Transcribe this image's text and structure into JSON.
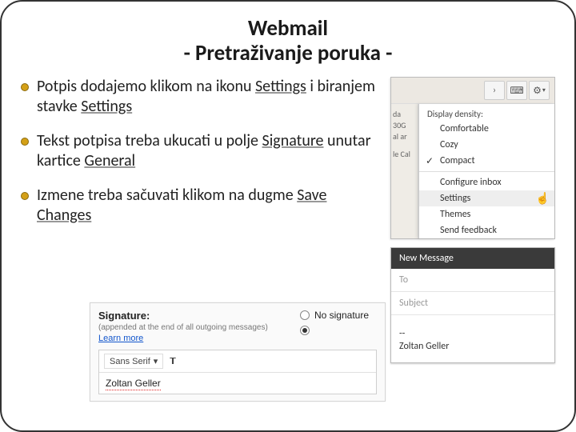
{
  "title_line1": "Webmail",
  "title_line2": "- Pretraživanje poruka -",
  "bullets": [
    {
      "pre": "Potpis dodajemo klikom na ikonu ",
      "u1": "Settings",
      "mid": " i biranjem stavke ",
      "u2": "Settings"
    },
    {
      "pre": "Tekst potpisa treba ukucati u polje ",
      "u1": "Signature",
      "mid": " unutar kartice ",
      "u2": "General"
    },
    {
      "pre": "Izmene treba sačuvati klikom na dugme ",
      "u1": "Save Changes",
      "mid": "",
      "u2": ""
    }
  ],
  "gmail": {
    "side": {
      "l1": "da",
      "l2": "30G",
      "l3": "al ar",
      "l4": "le Cal"
    },
    "dd_header": "Display density:",
    "options": [
      "Comfortable",
      "Cozy",
      "Compact"
    ],
    "items": [
      "Configure inbox",
      "Settings",
      "Themes",
      "Send feedback"
    ]
  },
  "compose": {
    "title": "New Message",
    "to": "To",
    "subject": "Subject",
    "sig_dash": "--",
    "sig_name": "Zoltan Geller"
  },
  "signature": {
    "label": "Signature:",
    "sub": "(appended at the end of all outgoing messages)",
    "learn": "Learn more",
    "no_sig": "No signature",
    "font_name": "Sans Serif",
    "value": "Zoltan Geller"
  }
}
